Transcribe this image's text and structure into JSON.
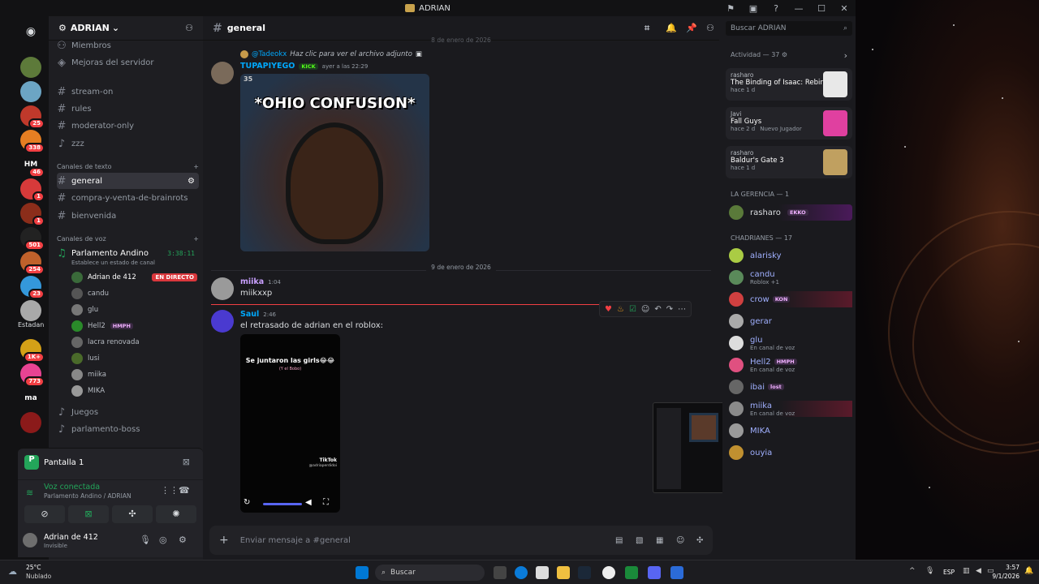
{
  "window": {
    "title": "ADRIAN"
  },
  "servers": {
    "items": [
      {
        "badge": "",
        "color": "#5d7a3a"
      },
      {
        "badge": "",
        "color": "#6ca5c4"
      },
      {
        "badge": "25",
        "color": "#c0392b"
      },
      {
        "badge": "338",
        "color": "#e67e22"
      },
      {
        "text": "HM",
        "badge": "46",
        "color": "#121214"
      },
      {
        "badge": "1",
        "color": "#d73a3a"
      },
      {
        "badge": "1",
        "color": "#8b2d1a"
      },
      {
        "badge": "501",
        "color": "#222"
      },
      {
        "badge": "254",
        "color": "#c0612b"
      },
      {
        "badge": "23",
        "color": "#3498db"
      },
      {
        "badge": "",
        "color": "#a9a9a9"
      }
    ],
    "label_estadan": "Estadan",
    "more_items": [
      {
        "badge": "1K+",
        "color": "#d4a017"
      },
      {
        "badge": "773",
        "color": "#e84393"
      },
      {
        "text": "ma",
        "badge": "",
        "color": "#121214"
      },
      {
        "badge": "",
        "color": "#8b1a1a"
      }
    ]
  },
  "sidebar": {
    "guild_name": "ADRIAN",
    "top_items": [
      {
        "label": "Miembros",
        "icon": "members-icon"
      },
      {
        "label": "Mejoras del servidor",
        "icon": "boost-icon"
      }
    ],
    "channels_top": [
      "stream-on",
      "rules",
      "moderator-only"
    ],
    "zzz": "zzz",
    "text_category": "Canales de texto",
    "text_channels": [
      "general",
      "compra-y-venta-de-brainrots",
      "bienvenida"
    ],
    "voice_category": "Canales de voz",
    "voice_channel": {
      "name": "Parlamento Andino",
      "timer": "3:38:11",
      "status": "Establece un estado de canal"
    },
    "voice_users": [
      {
        "name": "Adrian de 412",
        "live": "EN DIRECTO"
      },
      {
        "name": "candu"
      },
      {
        "name": "glu"
      },
      {
        "name": "Hell2",
        "tag": "HMPH"
      },
      {
        "name": "lacra renovada"
      },
      {
        "name": "lusi"
      },
      {
        "name": "miika"
      },
      {
        "name": "MIKA"
      }
    ],
    "more_voice": [
      "Juegos",
      "parlamento-boss"
    ]
  },
  "panel": {
    "screen": "Pantalla 1",
    "voice_status": "Voz conectada",
    "voice_location": "Parlamento Andino / ADRIAN",
    "user_name": "Adrian de 412",
    "user_status": "Invisible"
  },
  "chat": {
    "channel": "general",
    "date_top": "8 de enero de 2026",
    "reply": {
      "name": "@Tadeokx",
      "text": "Haz clic para ver el archivo adjunto"
    },
    "msg1": {
      "author": "TUPAPIYEGO",
      "tag": "KICK",
      "time": "ayer a las 22:29",
      "image_caption": "*OHIO CONFUSION*",
      "image_corner": "35"
    },
    "date_divider": "9 de enero de 2026",
    "msg2": {
      "author": "miika",
      "time": "1:04",
      "text": "miikxxp"
    },
    "msg3": {
      "author": "Saul",
      "time": "2:46",
      "text": "el retrasado de adrian en el roblox:",
      "video_caption": "Se juntaron las girls😂😂",
      "video_sub": "(Y el Bobo)",
      "video_brand": "TikTok",
      "video_handle": "@adriaperdidoi"
    },
    "input_placeholder": "Enviar mensaje a #general"
  },
  "search": {
    "placeholder": "Buscar ADRIAN"
  },
  "activity": {
    "header": "Actividad — 37",
    "cards": [
      {
        "user": "rasharo",
        "game": "The Binding of Isaac: Rebirth",
        "time": "hace 1 d"
      },
      {
        "user": "Javi",
        "game": "Fall Guys",
        "time": "hace 2 d",
        "extra": "Nuevo Jugador"
      },
      {
        "user": "rasharo",
        "game": "Baldur's Gate 3",
        "time": "hace 1 d"
      }
    ]
  },
  "members": {
    "gerencia_header": "LA GERENCIA — 1",
    "gerencia": [
      {
        "name": "rasharo",
        "tag": "EKKO"
      }
    ],
    "chadrianes_header": "CHADRIANES — 17",
    "list": [
      {
        "name": "alarisky",
        "sub": ""
      },
      {
        "name": "candu",
        "sub": "Roblox +1"
      },
      {
        "name": "crow",
        "tag": "KON",
        "sub": ""
      },
      {
        "name": "gerar",
        "sub": ""
      },
      {
        "name": "glu",
        "sub": "En canal de voz"
      },
      {
        "name": "Hell2",
        "tag": "HMPH",
        "sub": "En canal de voz"
      },
      {
        "name": "ibai",
        "tag": "lost",
        "sub": ""
      },
      {
        "name": "miika",
        "sub": "En canal de voz"
      },
      {
        "name": "MIKA",
        "sub": ""
      },
      {
        "name": "ouyia",
        "sub": ""
      }
    ]
  },
  "taskbar": {
    "weather_temp": "25°C",
    "weather_desc": "Nublado",
    "search": "Buscar",
    "lang": "ESP",
    "time": "3:57",
    "date": "9/1/2026"
  }
}
